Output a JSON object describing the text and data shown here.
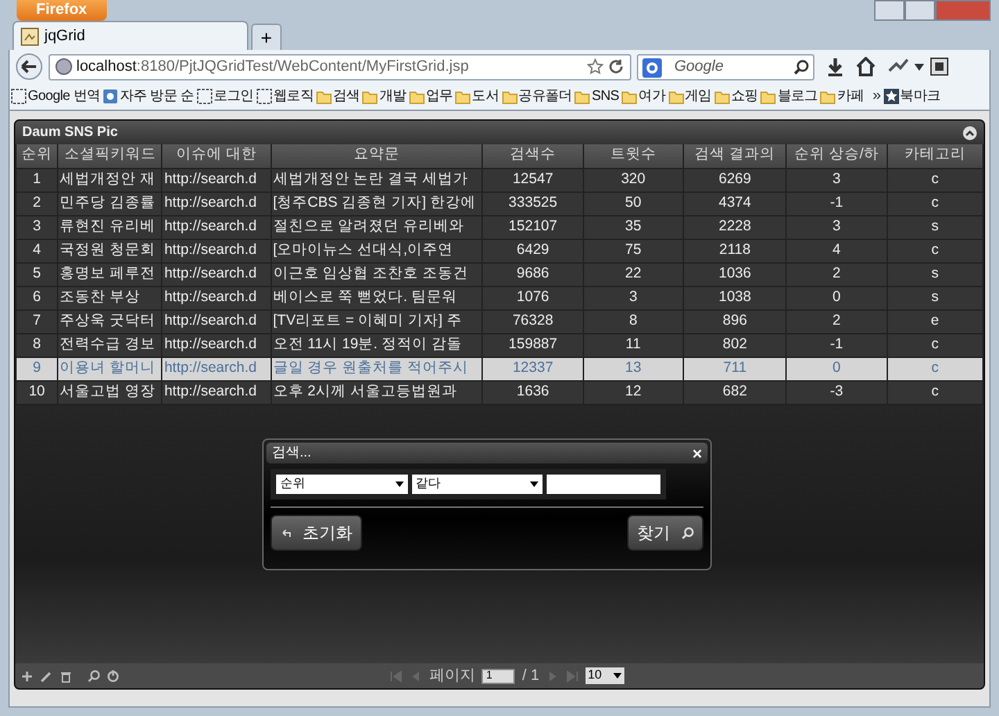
{
  "browser": {
    "menu_button": "Firefox",
    "tabs": [
      {
        "label": "jqGrid",
        "selected": true
      }
    ],
    "new_tab": "+",
    "url": {
      "host": "localhost",
      "path": ":8180/PjtJQGridTest/WebContent/MyFirstGrid.jsp"
    },
    "search": {
      "placeholder": "Google"
    },
    "bookmarks": [
      {
        "label": "Google 번역",
        "kind": "page"
      },
      {
        "label": "자주 방문 순",
        "kind": "smart"
      },
      {
        "label": "로그인",
        "kind": "page"
      },
      {
        "label": "웹로직",
        "kind": "page"
      },
      {
        "label": "검색",
        "kind": "folder"
      },
      {
        "label": "개발",
        "kind": "folder"
      },
      {
        "label": "업무",
        "kind": "folder"
      },
      {
        "label": "도서",
        "kind": "folder"
      },
      {
        "label": "공유폴더",
        "kind": "folder"
      },
      {
        "label": "SNS",
        "kind": "folder"
      },
      {
        "label": "여가",
        "kind": "folder"
      },
      {
        "label": "게임",
        "kind": "folder"
      },
      {
        "label": "쇼핑",
        "kind": "folder"
      },
      {
        "label": "블로그",
        "kind": "folder"
      },
      {
        "label": "카페",
        "kind": "folder"
      }
    ],
    "overflow": "»",
    "bookmarks_menu": "북마크"
  },
  "grid": {
    "caption": "Daum SNS Pic",
    "columns": [
      "순위",
      "소셜픽키워드",
      "이슈에 대한",
      "요약문",
      "검색수",
      "트윗수",
      "검색 결과의",
      "순위 상승/하",
      "카테고리"
    ],
    "rows": [
      {
        "cells": [
          "1",
          "세법개정안 재",
          "http://search.d",
          "세법개정안 논란 결국 세법가",
          "12547",
          "320",
          "6269",
          "3",
          "c"
        ],
        "selected": false
      },
      {
        "cells": [
          "2",
          "민주당 김종률",
          "http://search.d",
          "[청주CBS 김종현 기자] 한강에",
          "333525",
          "50",
          "4374",
          "-1",
          "c"
        ],
        "selected": false
      },
      {
        "cells": [
          "3",
          "류현진 유리베",
          "http://search.d",
          "절친으로 알려졌던 유리베와",
          "152107",
          "35",
          "2228",
          "3",
          "s"
        ],
        "selected": false
      },
      {
        "cells": [
          "4",
          "국정원 청문회",
          "http://search.d",
          "[오마이뉴스 선대식,이주연",
          "6429",
          "75",
          "2118",
          "4",
          "c"
        ],
        "selected": false
      },
      {
        "cells": [
          "5",
          "홍명보 페루전",
          "http://search.d",
          "이근호 임상협 조찬호 조동건",
          "9686",
          "22",
          "1036",
          "2",
          "s"
        ],
        "selected": false
      },
      {
        "cells": [
          "6",
          "조동찬 부상",
          "http://search.d",
          "베이스로 쭉 뻗었다. 팀문워",
          "1076",
          "3",
          "1038",
          "0",
          "s"
        ],
        "selected": false
      },
      {
        "cells": [
          "7",
          "주상욱 굿닥터",
          "http://search.d",
          "[TV리포트 = 이혜미 기자] 주",
          "76328",
          "8",
          "896",
          "2",
          "e"
        ],
        "selected": false
      },
      {
        "cells": [
          "8",
          "전력수급 경보",
          "http://search.d",
          "오전 11시 19분. 정적이 감돌",
          "159887",
          "11",
          "802",
          "-1",
          "c"
        ],
        "selected": false
      },
      {
        "cells": [
          "9",
          "이용녀 할머니",
          "http://search.d",
          "글일 경우 원출처를 적어주시",
          "12337",
          "13",
          "711",
          "0",
          "c"
        ],
        "selected": true
      },
      {
        "cells": [
          "10",
          "서울고법 영장",
          "http://search.d",
          "오후 2시께 서울고등법원과",
          "1636",
          "12",
          "682",
          "-3",
          "c"
        ],
        "selected": false
      }
    ],
    "search_dialog": {
      "title": "검색...",
      "close": "×",
      "field": "순위",
      "operator": "같다",
      "buttons": [
        {
          "label": "초기화",
          "kind": "reset"
        },
        {
          "label": "찾기",
          "kind": "find"
        }
      ]
    },
    "pager": {
      "page_label": "페이지",
      "page": "1",
      "total": "/ 1",
      "rows_per_page": "10"
    }
  }
}
